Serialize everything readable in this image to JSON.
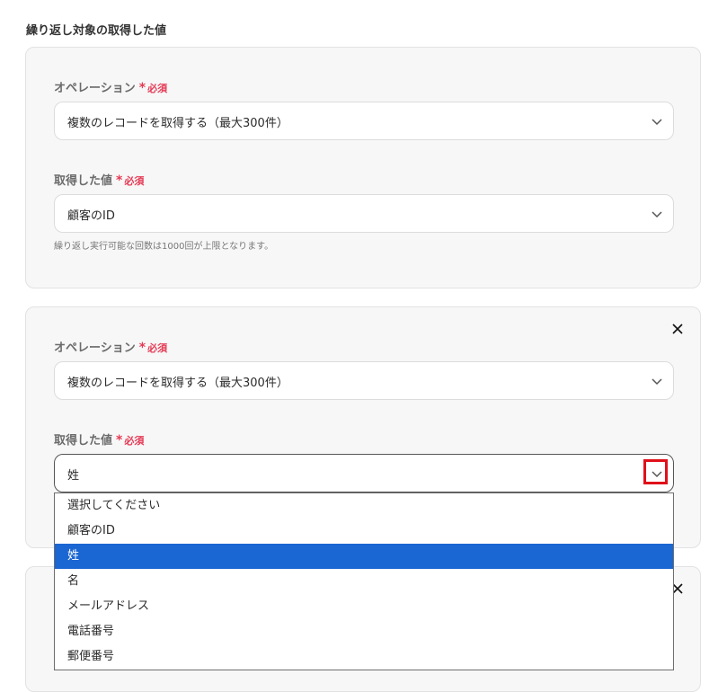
{
  "section_title": "繰り返し対象の取得した値",
  "required_mark": "*",
  "required_text": "必須",
  "cards": [
    {
      "operation_label": "オペレーション",
      "operation_value": "複数のレコードを取得する（最大300件）",
      "value_label": "取得した値",
      "value_value": "顧客のID",
      "hint": "繰り返し実行可能な回数は1000回が上限となります。"
    },
    {
      "operation_label": "オペレーション",
      "operation_value": "複数のレコードを取得する（最大300件）",
      "value_label": "取得した値",
      "value_value": "姓"
    }
  ],
  "dropdown_options": [
    "選択してください",
    "顧客のID",
    "姓",
    "名",
    "メールアドレス",
    "電話番号",
    "郵便番号"
  ],
  "selected_option": "姓",
  "colors": {
    "required": "#e53a55",
    "selected_option_bg": "#1a66d2",
    "highlight_box": "#e0101a"
  },
  "icons": {
    "chevron": "chevron-down-icon",
    "close": "close-icon"
  }
}
